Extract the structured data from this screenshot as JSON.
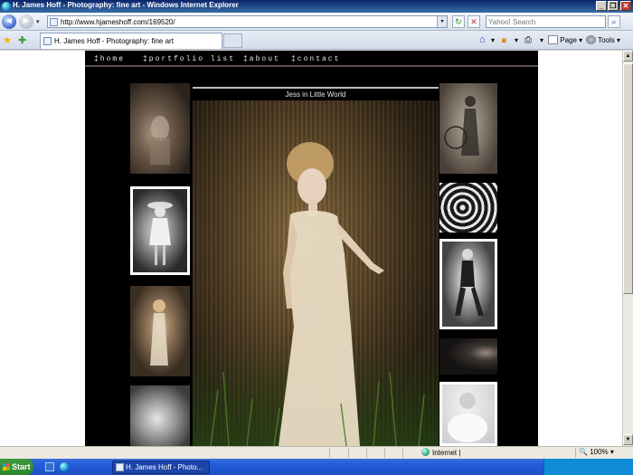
{
  "window": {
    "title": "H. James Hoff - Photography: fine art - Windows Internet Explorer",
    "minimize": "_",
    "restore": "❐",
    "close": "✕"
  },
  "address_bar": {
    "back": "◄",
    "forward": "►",
    "url": "http://www.hjameshoff.com/169520/",
    "refresh": "↻",
    "stop": "✕",
    "search_placeholder": "Yahoo! Search",
    "search_button": "⌕"
  },
  "tabs": [
    {
      "label": "H. James Hoff - Photography: fine art"
    }
  ],
  "command_bar": {
    "home": "⌂",
    "feeds": "◙",
    "print": "⎙",
    "page_label": "Page",
    "tools_label": "Tools",
    "dropdown": "▾"
  },
  "site": {
    "nav": [
      {
        "label": "‡home"
      },
      {
        "label": "‡portfolio list"
      },
      {
        "label": "‡about"
      },
      {
        "label": "‡contact"
      }
    ],
    "photo_title": "Jess in Little World",
    "thumbnails_left": [
      "thumbnail-1",
      "thumbnail-2",
      "thumbnail-3",
      "thumbnail-4"
    ],
    "thumbnails_right": [
      "thumbnail-5",
      "thumbnail-6",
      "thumbnail-7",
      "thumbnail-8",
      "thumbnail-9"
    ]
  },
  "status_bar": {
    "zone": "Internet |",
    "zoom": "100%"
  },
  "taskbar": {
    "start": "Start",
    "active_window": "H. James Hoff - Photo..."
  },
  "colors": {
    "titlebar": "#0a246a",
    "site_background": "#000000",
    "nav_text": "#e8e8e8",
    "taskbar": "#245edb",
    "start_button": "#3c9a3c"
  }
}
